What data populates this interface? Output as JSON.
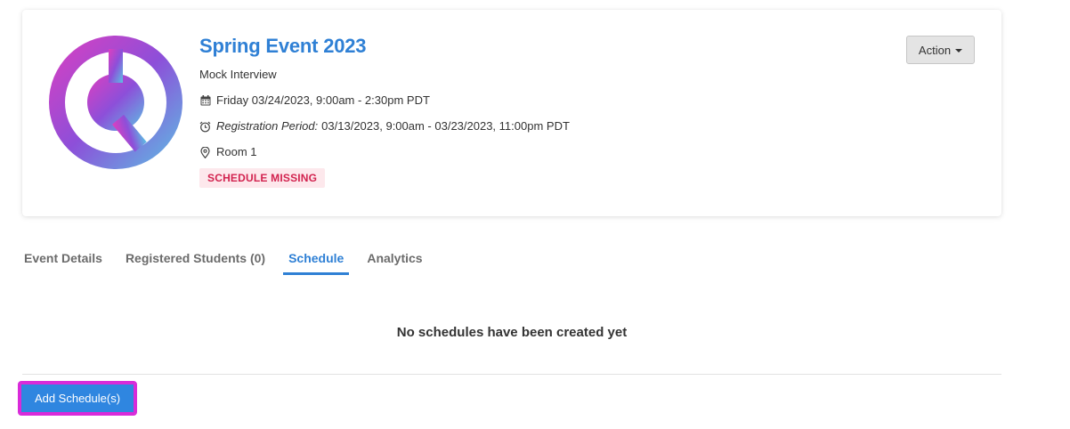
{
  "event": {
    "title": "Spring Event 2023",
    "type": "Mock Interview",
    "date_time": "Friday 03/24/2023, 9:00am - 2:30pm PDT",
    "registration_label": "Registration Period:",
    "registration_period": "03/13/2023, 9:00am - 03/23/2023, 11:00pm PDT",
    "location": "Room 1",
    "status_badge": "SCHEDULE MISSING",
    "logo_icon": "event-logo-icon",
    "colors": {
      "title": "#2f80d5",
      "badge_text": "#d2234f",
      "badge_bg": "#fde8ec",
      "logo_gradient_start": "#d63fc4",
      "logo_gradient_mid": "#8a4fd8",
      "logo_gradient_end": "#5fb5e3"
    }
  },
  "action_button": {
    "label": "Action",
    "icon": "caret-down-icon"
  },
  "tabs": [
    {
      "label": "Event Details",
      "active": false
    },
    {
      "label": "Registered Students (0)",
      "active": false
    },
    {
      "label": "Schedule",
      "active": true
    },
    {
      "label": "Analytics",
      "active": false
    }
  ],
  "schedule": {
    "empty_message": "No schedules have been created yet",
    "add_button_label": "Add Schedule(s)"
  },
  "colors": {
    "accent": "#2f80d5",
    "button_primary": "#2f86e0",
    "focus_outline": "#d92ad9"
  }
}
